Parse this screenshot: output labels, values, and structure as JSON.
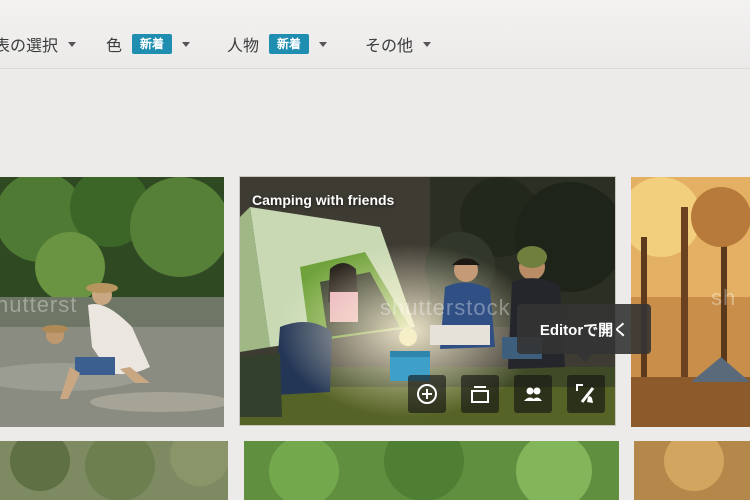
{
  "filters": [
    {
      "label": "最後の選択",
      "visible_label": "表の選択",
      "badge": ""
    },
    {
      "label": "色",
      "badge": "新着"
    },
    {
      "label": "人物",
      "badge": "新着"
    },
    {
      "label": "その他",
      "badge": ""
    }
  ],
  "filter_labels": {
    "f0": "表の選択",
    "f1": "色",
    "f2": "人物",
    "f3": "その他"
  },
  "badges": {
    "color": "新着",
    "people": "新着"
  },
  "featured": {
    "caption": "Camping with friends",
    "tooltip": "Editorで開く"
  },
  "watermarks": {
    "left": "hutterst",
    "center": "shutterstock",
    "right": "sh"
  },
  "colors": {
    "badge": "#1f8eb0",
    "tooltip_bg": "#343434",
    "page_bg": "#ecebea"
  },
  "icons": {
    "action_1": "add-circle-icon",
    "action_2": "lightbox-icon",
    "action_3": "similar-people-icon",
    "action_4": "open-in-editor-icon"
  }
}
